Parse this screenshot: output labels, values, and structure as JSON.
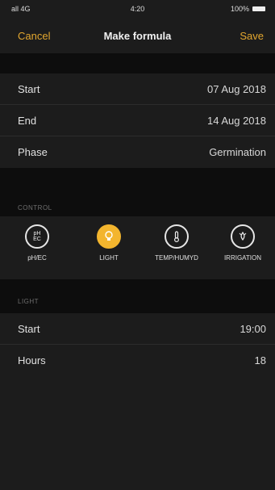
{
  "status": {
    "carrier": "all 4G",
    "time": "4:20",
    "battery": "100%"
  },
  "nav": {
    "cancel": "Cancel",
    "title": "Make formula",
    "save": "Save"
  },
  "schedule": {
    "rows": [
      {
        "label": "Start",
        "value": "07 Aug 2018"
      },
      {
        "label": "End",
        "value": "14 Aug 2018"
      },
      {
        "label": "Phase",
        "value": "Germination"
      }
    ]
  },
  "control": {
    "header": "CONTROL",
    "items": [
      {
        "label": "pH/EC",
        "icon": "ph-ec-icon",
        "glyph": "pH EC",
        "active": false
      },
      {
        "label": "LIGHT",
        "icon": "light-icon",
        "glyph": "💡",
        "active": true
      },
      {
        "label": "TEMP/HUMYD",
        "icon": "temp-humidity-icon",
        "glyph": "🌡",
        "active": false
      },
      {
        "label": "IRRIGATION",
        "icon": "irrigation-icon",
        "glyph": "💧",
        "active": false
      }
    ]
  },
  "light": {
    "header": "LIGHT",
    "rows": [
      {
        "label": "Start",
        "value": "19:00"
      },
      {
        "label": "Hours",
        "value": "18"
      }
    ]
  },
  "colors": {
    "accent": "#e3a72f",
    "active_circle": "#f3b52e",
    "panel": "#1c1c1c",
    "background": "#0d0d0d"
  }
}
